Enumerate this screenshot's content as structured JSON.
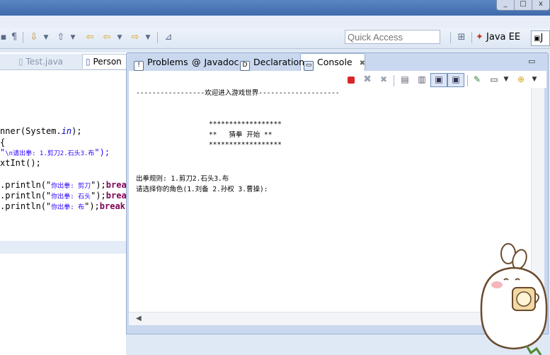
{
  "window": {
    "buttons": [
      "_",
      "□",
      "x"
    ]
  },
  "toolbar": {
    "quick_access_placeholder": "Quick Access",
    "perspective_java_ee": "Java EE",
    "perspective_java": "J"
  },
  "editor": {
    "tabs": [
      {
        "label": "Test.java"
      },
      {
        "label": "Person"
      }
    ],
    "lines": [
      {
        "text": "nner(System.",
        "italic": "in",
        "after": ");"
      },
      {
        "text": "{"
      },
      {
        "pre": "\"",
        "str": "\\n请出拳: 1.剪刀2.石头3.布",
        "post": "\");"
      },
      {
        "text": "xtInt();"
      },
      {
        "text": ""
      },
      {
        "pre": ".println(\"",
        "str": "你出拳: 剪刀",
        "post": "\");",
        "kw": "break"
      },
      {
        "pre": ".println(\"",
        "str": "你出拳: 石头",
        "post": "\");",
        "kw": "break"
      },
      {
        "pre": ".println(\"",
        "str": "你出拳: 布",
        "post": "\");",
        "kw": "break;"
      }
    ]
  },
  "view": {
    "tabs": [
      {
        "label": "Problems",
        "icon": "problems-icon"
      },
      {
        "label": "Javadoc",
        "icon": "javadoc-icon"
      },
      {
        "label": "Declaration",
        "icon": "declaration-icon"
      },
      {
        "label": "Console",
        "icon": "console-icon"
      }
    ],
    "close_glyph": "✖"
  },
  "console": {
    "lines": [
      "-----------------欢迎进入游戏世界--------------------",
      "",
      "",
      "                  ******************",
      "                  **   猜拳 开始 **",
      "                  ******************",
      "",
      "",
      "",
      "出拳规则: 1.剪刀2.石头3.布",
      "请选择你的角色(1.刘备 2.孙权 3.曹操):"
    ]
  },
  "colors": {
    "accent": "#3f6aab",
    "terminate": "#d9262b",
    "string": "#2a00ff",
    "keyword": "#7f0055"
  }
}
